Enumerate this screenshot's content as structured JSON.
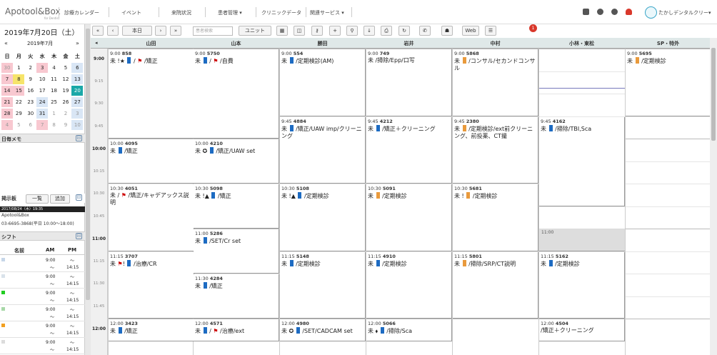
{
  "header": {
    "logo": "Apotool&Box",
    "logo_sub": "for Dentist",
    "nav": [
      "診療カレンダー",
      "イベント",
      "来院状況",
      "患者管理 ▾",
      "クリニックデータ",
      "関連サービス ▾"
    ],
    "clinic_name": "たかしデンタルクリー▾"
  },
  "sidebar": {
    "date_title": "2019年7月20日（土）",
    "cal_prev": "«",
    "cal_next": "»",
    "cal_month": "2019年7月",
    "dow": [
      "日",
      "月",
      "火",
      "水",
      "木",
      "金",
      "土"
    ],
    "weeks": [
      [
        "30",
        "1",
        "2",
        "3",
        "4",
        "5",
        "6"
      ],
      [
        "7",
        "8",
        "9",
        "10",
        "11",
        "12",
        "13"
      ],
      [
        "14",
        "15",
        "16",
        "17",
        "18",
        "19",
        "20"
      ],
      [
        "21",
        "22",
        "23",
        "24",
        "25",
        "26",
        "27"
      ],
      [
        "28",
        "29",
        "30",
        "31",
        "1",
        "2",
        "3"
      ],
      [
        "4",
        "5",
        "6",
        "7",
        "8",
        "9",
        "10"
      ]
    ],
    "memo_title": "日毎メモ",
    "notice_title": "掲示板",
    "notice_list_label": "一覧",
    "notice_add_label": "追加",
    "notice_date": "2017/08/24（木）19:35",
    "notice_line1": "Apotool&Box",
    "notice_line2": "03-6695-3868(平日 10:00〜18:00)",
    "shift_title": "シフト",
    "shift_headers": [
      "名前",
      "AM",
      "PM"
    ],
    "shift_rows": [
      {
        "am": "9:00",
        "am2": "〜",
        "pm": "〜",
        "pm2": "14:15",
        "color": "#c6d6e8"
      },
      {
        "am": "9:00",
        "am2": "〜",
        "pm": "〜",
        "pm2": "14:15",
        "color": "#d9e2ea"
      },
      {
        "am": "9:00",
        "am2": "〜",
        "pm": "〜",
        "pm2": "14:15",
        "color": "#22cc22"
      },
      {
        "am": "9:00",
        "am2": "〜",
        "pm": "〜",
        "pm2": "14:15",
        "color": "#a8d8a8"
      },
      {
        "am": "9:00",
        "am2": "〜",
        "pm": "〜",
        "pm2": "14:15",
        "color": "#f2a020"
      },
      {
        "am": "9:00",
        "am2": "〜",
        "pm": "〜",
        "pm2": "14:15",
        "color": "#dcdcdc"
      }
    ]
  },
  "toolbar": {
    "prev_fast": "«",
    "prev": "‹",
    "today": "本日",
    "next": "›",
    "next_fast": "»",
    "search_placeholder": "患者検索",
    "unit": "ユニット",
    "badge_count": "1",
    "web": "Web"
  },
  "columns": [
    "山田",
    "山本",
    "勝田",
    "岩井",
    "中村",
    "小林・東松",
    "SP・特外"
  ],
  "times": [
    {
      "t": "9:00",
      "hour": true
    },
    {
      "t": "9:15",
      "hour": false
    },
    {
      "t": "9:30",
      "hour": false
    },
    {
      "t": "9:45",
      "hour": false
    },
    {
      "t": "10:00",
      "hour": true
    },
    {
      "t": "10:15",
      "hour": false
    },
    {
      "t": "10:30",
      "hour": false
    },
    {
      "t": "10:45",
      "hour": false
    },
    {
      "t": "11:00",
      "hour": true
    },
    {
      "t": "11:15",
      "hour": false
    },
    {
      "t": "11:30",
      "hour": false
    },
    {
      "t": "11:45",
      "hour": false
    },
    {
      "t": "12:00",
      "hour": true
    }
  ],
  "appointments": [
    {
      "col": 0,
      "start": 0,
      "span": 4,
      "time": "9:00",
      "num": "858",
      "body": "未 !★ ■ / ⚑ /矯正"
    },
    {
      "col": 0,
      "start": 4,
      "span": 2,
      "time": "10:00",
      "num": "4095",
      "body": "未 ■ /矯正"
    },
    {
      "col": 0,
      "start": 6,
      "span": 3,
      "time": "10:30",
      "num": "4051",
      "body": "未 / ⚑ /矯正/キャデアックス説明"
    },
    {
      "col": 0,
      "start": 9,
      "span": 3,
      "time": "11:15",
      "num": "3707",
      "body": "未 ⚑! ■ /治療/CR"
    },
    {
      "col": 0,
      "start": 12,
      "span": 1,
      "time": "12:00",
      "num": "3423",
      "body": "未 ■ /矯正"
    },
    {
      "col": 1,
      "start": 0,
      "span": 4,
      "time": "9:00",
      "num": "5750",
      "body": "未 ■ / ⚑ /自費"
    },
    {
      "col": 1,
      "start": 4,
      "span": 2,
      "time": "10:00",
      "num": "4210",
      "body": "未 ✪ ■ /矯正/UAW set"
    },
    {
      "col": 1,
      "start": 6,
      "span": 2,
      "time": "10:30",
      "num": "5098",
      "body": "未 !▲ ■ /矯正"
    },
    {
      "col": 1,
      "start": 8,
      "span": 2,
      "time": "11:00",
      "num": "5286",
      "body": "未 ■ /SET/Cr set"
    },
    {
      "col": 1,
      "start": 10,
      "span": 2,
      "time": "11:30",
      "num": "4284",
      "body": "未 ■ /矯正"
    },
    {
      "col": 1,
      "start": 12,
      "span": 1,
      "time": "12:00",
      "num": "4571",
      "body": "未 ■ / ⚑ /治療/ext"
    },
    {
      "col": 2,
      "start": 0,
      "span": 3,
      "time": "9:00",
      "num": "554",
      "body": "未 ■ /定期検診(AM)"
    },
    {
      "col": 2,
      "start": 3,
      "span": 3,
      "time": "9:45",
      "num": "4884",
      "body": "未 ■ /矯正/UAW imp/クリーニング"
    },
    {
      "col": 2,
      "start": 6,
      "span": 3,
      "time": "10:30",
      "num": "5108",
      "body": "未 !▲ ■ /定期検診"
    },
    {
      "col": 2,
      "start": 9,
      "span": 3,
      "time": "11:15",
      "num": "5148",
      "body": "未 ■ /定期検診"
    },
    {
      "col": 2,
      "start": 12,
      "span": 1,
      "time": "12:00",
      "num": "4980",
      "body": "未 ✪ ■ /SET/CADCAM set"
    },
    {
      "col": 3,
      "start": 0,
      "span": 3,
      "time": "9:00",
      "num": "749",
      "body": "未 /掃除/Epp/口写"
    },
    {
      "col": 3,
      "start": 3,
      "span": 3,
      "time": "9:45",
      "num": "4212",
      "body": "未 ■ /矯正＋クリーニング"
    },
    {
      "col": 3,
      "start": 6,
      "span": 3,
      "time": "10:30",
      "num": "5091",
      "body": "未 ■ /定期検診",
      "orange": true
    },
    {
      "col": 3,
      "start": 9,
      "span": 3,
      "time": "11:15",
      "num": "4910",
      "body": "未 ■ /定期検診"
    },
    {
      "col": 3,
      "start": 12,
      "span": 1,
      "time": "12:00",
      "num": "5066",
      "body": "未 ⬧ ■ /掃除/Sca"
    },
    {
      "col": 4,
      "start": 0,
      "span": 3,
      "time": "9:00",
      "num": "5868",
      "body": "未 ■ /コンサル/セカンドコンサル",
      "orange": true
    },
    {
      "col": 4,
      "start": 3,
      "span": 3,
      "time": "9:45",
      "num": "2380",
      "body": "未 ■ /定期検診/ext前クリーニング、前投薬、CT撮",
      "orange": true
    },
    {
      "col": 4,
      "start": 6,
      "span": 3,
      "time": "10:30",
      "num": "5681",
      "body": "未 ! ■ /定期検診",
      "orange": true
    },
    {
      "col": 4,
      "start": 9,
      "span": 3,
      "time": "11:15",
      "num": "5801",
      "body": "未 ■ /掃除/SRP/CT説明",
      "orange": true
    },
    {
      "col": 5,
      "start": 3,
      "span": 4,
      "time": "9:45",
      "num": "4162",
      "body": "未 ■ /掃除/TBI,Sca"
    },
    {
      "col": 5,
      "start": 9,
      "span": 3,
      "time": "11:15",
      "num": "5162",
      "body": "未 ■ /定期検診"
    },
    {
      "col": 5,
      "start": 12,
      "span": 1,
      "time": "12:00",
      "num": "4504",
      "body": "/矯正＋クリーニング"
    },
    {
      "col": 6,
      "start": 0,
      "span": 3,
      "time": "9:00",
      "num": "5695",
      "body": "未 ■ /定期検診",
      "orange": true
    }
  ],
  "gray_block": {
    "label": "11:00"
  }
}
